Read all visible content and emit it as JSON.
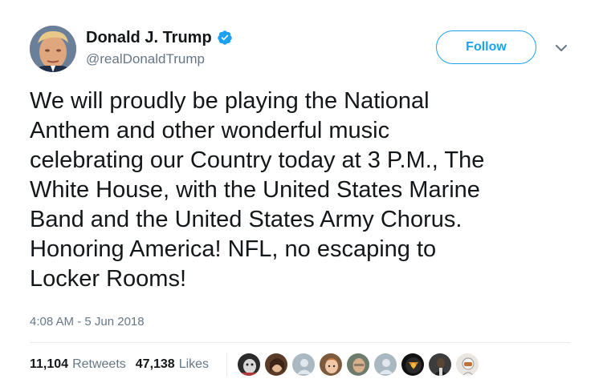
{
  "user": {
    "display_name": "Donald J. Trump",
    "handle": "@realDonaldTrump",
    "verified": true,
    "avatar_icon": "profile-photo"
  },
  "actions": {
    "follow_label": "Follow",
    "more_icon": "chevron-down-icon"
  },
  "tweet": {
    "text": "We will proudly be playing the National\nAnthem and other wonderful music\ncelebrating our Country today at 3 P.M., The\nWhite House, with the United States Marine\nBand and the United States Army Chorus.\nHonoring America! NFL, no escaping to\nLocker Rooms!",
    "timestamp": "4:08 AM - 5 Jun 2018"
  },
  "stats": {
    "retweets_count": "11,104",
    "retweets_label": "Retweets",
    "likes_count": "47,138",
    "likes_label": "Likes"
  },
  "likers": [
    {
      "icon": "user-avatar-photo"
    },
    {
      "icon": "user-avatar-photo"
    },
    {
      "icon": "default-user-icon"
    },
    {
      "icon": "user-avatar-photo"
    },
    {
      "icon": "user-avatar-photo"
    },
    {
      "icon": "default-user-icon"
    },
    {
      "icon": "user-avatar-photo"
    },
    {
      "icon": "user-avatar-photo"
    },
    {
      "icon": "user-avatar-photo"
    }
  ],
  "colors": {
    "accent": "#1da1f2",
    "text_primary": "#14171a",
    "text_secondary": "#657786",
    "divider": "#e6ecf0",
    "default_avatar": "#aab8c2"
  }
}
